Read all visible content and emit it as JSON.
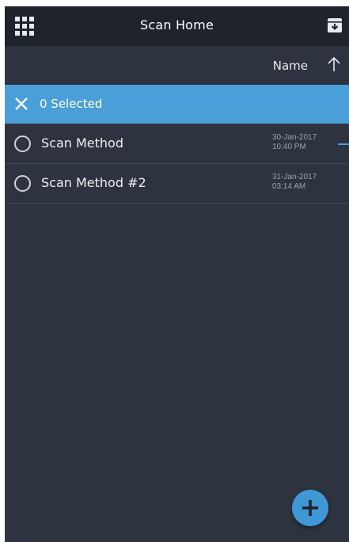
{
  "header": {
    "title": "Scan Home",
    "menu_icon": "grid-icon",
    "action_icon": "archive-download-icon"
  },
  "sort": {
    "label": "Name",
    "direction_icon": "arrow-up-icon"
  },
  "selection": {
    "count_label": "0 Selected",
    "close_icon": "close-icon"
  },
  "list": {
    "items": [
      {
        "title": "Scan Method",
        "date": "30-Jan-2017",
        "time": "10:40 PM"
      },
      {
        "title": "Scan Method #2",
        "date": "31-Jan-2017",
        "time": "03:14 AM"
      }
    ]
  },
  "fab": {
    "icon": "plus-icon"
  },
  "colors": {
    "topbar": "#1f232b",
    "background": "#2d3440",
    "accent": "#4a9fd8",
    "fab": "#3f97d6"
  }
}
